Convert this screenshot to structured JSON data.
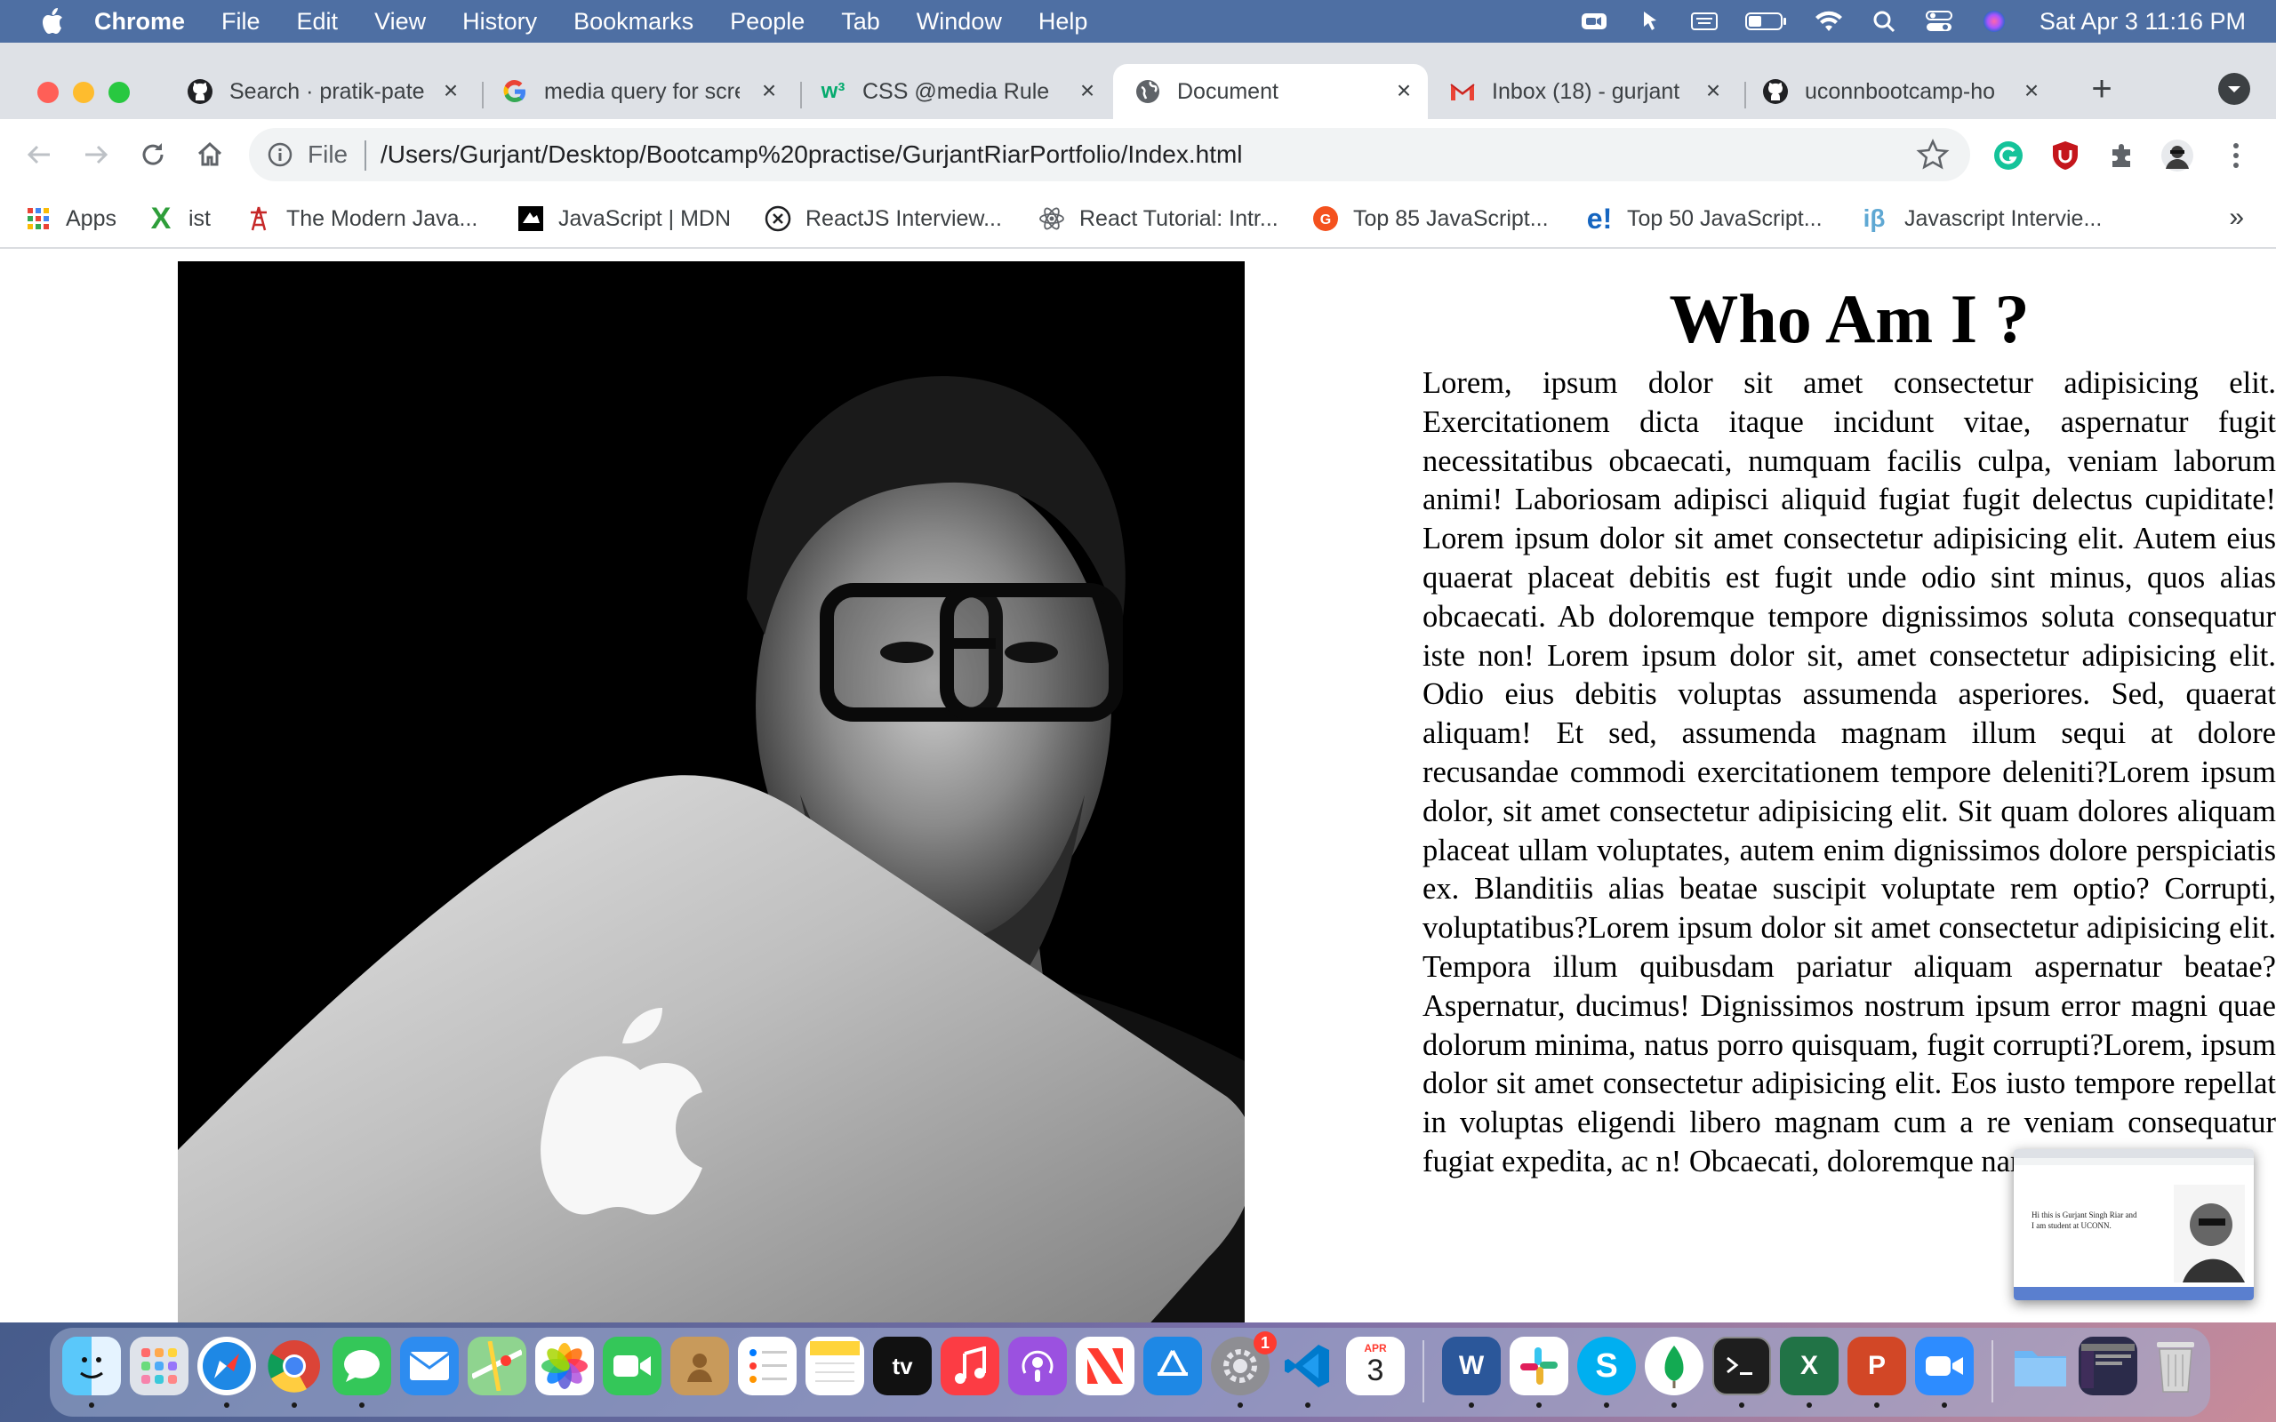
{
  "menubar": {
    "app": "Chrome",
    "items": [
      "File",
      "Edit",
      "View",
      "History",
      "Bookmarks",
      "People",
      "Tab",
      "Window",
      "Help"
    ],
    "clock": "Sat Apr 3  11:16 PM",
    "icons": [
      "zoom-icon",
      "paste-icon",
      "keyboard-icon",
      "battery-icon",
      "wifi-icon",
      "spotlight-icon",
      "control-center-icon",
      "siri-icon"
    ]
  },
  "tabs": [
    {
      "title": "Search · pratik-pate",
      "icon": "github-icon"
    },
    {
      "title": "media query for scre",
      "icon": "google-icon"
    },
    {
      "title": "CSS @media Rule",
      "icon": "w3schools-icon"
    },
    {
      "title": "Document",
      "icon": "globe-icon",
      "active": true
    },
    {
      "title": "Inbox (18) - gurjant",
      "icon": "gmail-icon"
    },
    {
      "title": "uconnbootcamp-ho",
      "icon": "github-icon"
    }
  ],
  "omnibox": {
    "scheme": "File",
    "url": "/Users/Gurjant/Desktop/Bootcamp%20practise/GurjantRiarPortfolio/Index.html"
  },
  "bookmarks": [
    {
      "label": "Apps",
      "icon": "apps-grid-icon"
    },
    {
      "label": "ist",
      "icon": "x-logo-icon"
    },
    {
      "label": "The Modern Java...",
      "icon": "tower-icon"
    },
    {
      "label": "JavaScript | MDN",
      "icon": "mdn-icon"
    },
    {
      "label": "ReactJS Interview...",
      "icon": "x-circle-icon"
    },
    {
      "label": "React Tutorial: Intr...",
      "icon": "react-icon"
    },
    {
      "label": "Top 85 JavaScript...",
      "icon": "guru99-icon"
    },
    {
      "label": "Top 50 JavaScript...",
      "icon": "edureka-icon"
    },
    {
      "label": "Javascript Intervie...",
      "icon": "interviewbit-icon"
    }
  ],
  "bookmarks_more": "»",
  "page": {
    "heading": "Who Am I ?",
    "paragraph": "Lorem, ipsum dolor sit amet consectetur adipisicing elit. Exercitationem dicta itaque incidunt vitae, aspernatur fugit necessitatibus obcaecati, numquam facilis culpa, veniam laborum animi! Laboriosam adipisci aliquid fugiat fugit delectus cupiditate! Lorem ipsum dolor sit amet consectetur adipisicing elit. Autem eius quaerat placeat debitis est fugit unde odio sint minus, quos alias obcaecati. Ab doloremque tempore dignissimos soluta consequatur iste non! Lorem ipsum dolor sit, amet consectetur adipisicing elit. Odio eius debitis voluptas assumenda asperiores. Sed, quaerat aliquam! Et sed, assumenda magnam illum sequi at dolore recusandae commodi exercitationem tempore deleniti?Lorem ipsum dolor, sit amet consectetur adipisicing elit. Sit quam dolores aliquam placeat ullam voluptates, autem enim dignissimos dolore perspiciatis ex. Blanditiis alias beatae suscipit voluptate rem optio? Corrupti, voluptatibus?Lorem ipsum dolor sit amet consectetur adipisicing elit. Tempora illum quibusdam pariatur aliquam aspernatur beatae? Aspernatur, ducimus! Dignissimos nostrum ipsum error magni quae dolorum minima, natus porro quisquam, fugit corrupti?Lorem, ipsum dolor sit amet consectetur adipisicing elit. Eos iusto tempore repellat in voluptas eligendi libero magnam cum a re veniam consequatur fugiat expedita, ac n! Obcaecati, doloremque nam!LoremLo ctetu",
    "thumbnail_text": "Hi this is Gurjant Singh Riar and I am student at UCONN."
  },
  "dock": {
    "apps": [
      "finder-icon",
      "launchpad-icon",
      "safari-icon",
      "chrome-icon",
      "messages-icon",
      "mail-icon",
      "maps-icon",
      "photos-icon",
      "facetime-icon",
      "contacts-icon",
      "reminders-icon",
      "notes-icon",
      "appletv-icon",
      "music-icon",
      "podcasts-icon",
      "news-icon",
      "appstore-icon",
      "system-preferences-icon",
      "vscode-icon",
      "calendar-icon",
      "word-icon",
      "slack-icon",
      "skype-icon",
      "mongodb-icon",
      "terminal-icon",
      "excel-icon",
      "powerpoint-icon",
      "zoom-icon",
      "downloads-folder-icon",
      "recent-window-icon",
      "trash-icon"
    ],
    "calendar_month": "APR",
    "calendar_day": "3",
    "system_prefs_badge": "1",
    "appletv_label": "tv"
  },
  "colors": {
    "menubar": "#4e6fa3",
    "tabstrip": "#dee1e6",
    "omnibox": "#f1f3f4",
    "page_bg": "#ffffff"
  }
}
